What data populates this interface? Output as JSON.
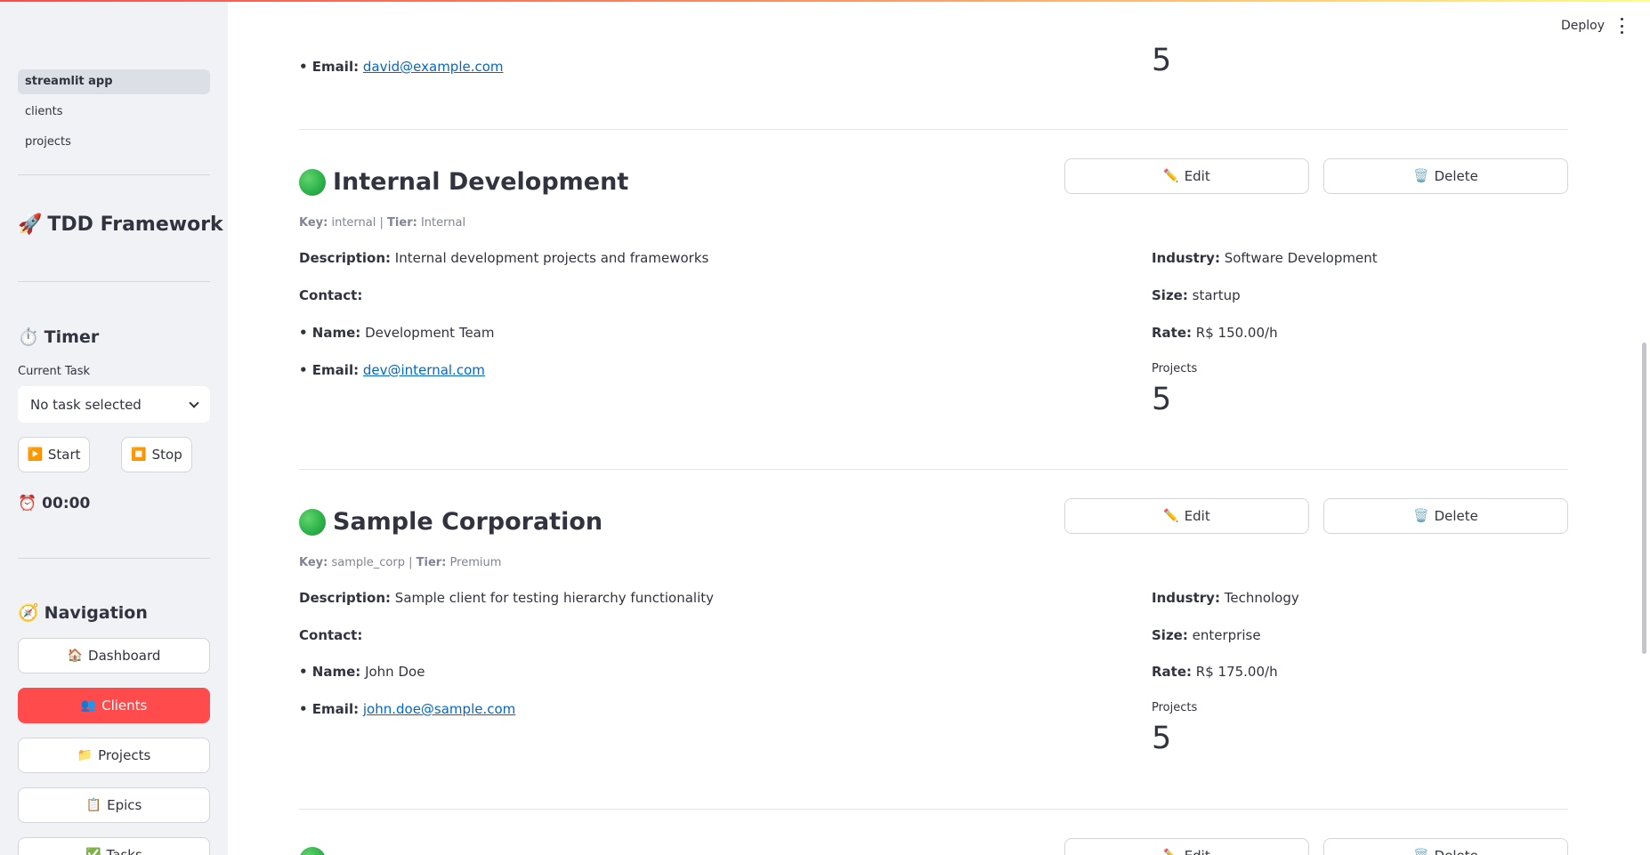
{
  "sidebar": {
    "pages": [
      {
        "label": "streamlit app",
        "active": true
      },
      {
        "label": "clients",
        "active": false
      },
      {
        "label": "projects",
        "active": false
      }
    ],
    "app_title": "TDD Framework",
    "app_icon": "🚀",
    "timer": {
      "heading": "Timer",
      "heading_icon": "⏱️",
      "current_task_label": "Current Task",
      "select_value": "No task selected",
      "start_label": "Start",
      "start_icon": "▶️",
      "stop_label": "Stop",
      "stop_icon": "⏹️",
      "display": "00:00",
      "display_icon": "⏰"
    },
    "navigation": {
      "heading": "Navigation",
      "heading_icon": "🧭",
      "items": [
        {
          "label": "Dashboard",
          "icon": "🏠",
          "active": false
        },
        {
          "label": "Clients",
          "icon": "👥",
          "active": true
        },
        {
          "label": "Projects",
          "icon": "📁",
          "active": false
        },
        {
          "label": "Epics",
          "icon": "📋",
          "active": false
        },
        {
          "label": "Tasks",
          "icon": "✅",
          "active": false
        }
      ]
    }
  },
  "header": {
    "deploy_label": "Deploy"
  },
  "top_partial": {
    "email_label": "• Email:",
    "email": "david@example.com",
    "projects_value": "5"
  },
  "clients": [
    {
      "name": "Internal Development",
      "key_label": "Key:",
      "key": "internal",
      "tier_label": "Tier:",
      "tier": "Internal",
      "description_label": "Description:",
      "description": "Internal development projects and frameworks",
      "contact_label": "Contact:",
      "name_label": "• Name:",
      "contact_name": "Development Team",
      "email_label": "• Email:",
      "email": "dev@internal.com",
      "industry_label": "Industry:",
      "industry": "Software Development",
      "size_label": "Size:",
      "size": "startup",
      "rate_label": "Rate:",
      "rate": "R$ 150.00/h",
      "projects_label": "Projects",
      "projects": "5",
      "edit_label": "Edit",
      "delete_label": "Delete"
    },
    {
      "name": "Sample Corporation",
      "key_label": "Key:",
      "key": "sample_corp",
      "tier_label": "Tier:",
      "tier": "Premium",
      "description_label": "Description:",
      "description": "Sample client for testing hierarchy functionality",
      "contact_label": "Contact:",
      "name_label": "• Name:",
      "contact_name": "John Doe",
      "email_label": "• Email:",
      "email": "john.doe@sample.com",
      "industry_label": "Industry:",
      "industry": "Technology",
      "size_label": "Size:",
      "size": "enterprise",
      "rate_label": "Rate:",
      "rate": "R$ 175.00/h",
      "projects_label": "Projects",
      "projects": "5",
      "edit_label": "Edit",
      "delete_label": "Delete"
    }
  ],
  "next_partial": {
    "edit_label": "Edit",
    "delete_label": "Delete"
  },
  "icons": {
    "edit": "✏️",
    "delete": "🗑️"
  },
  "colors": {
    "primary": "#ff4b4b",
    "link": "#0068c9",
    "status_dot": "#2eb34a",
    "sidebar_bg": "#f0f2f6"
  }
}
